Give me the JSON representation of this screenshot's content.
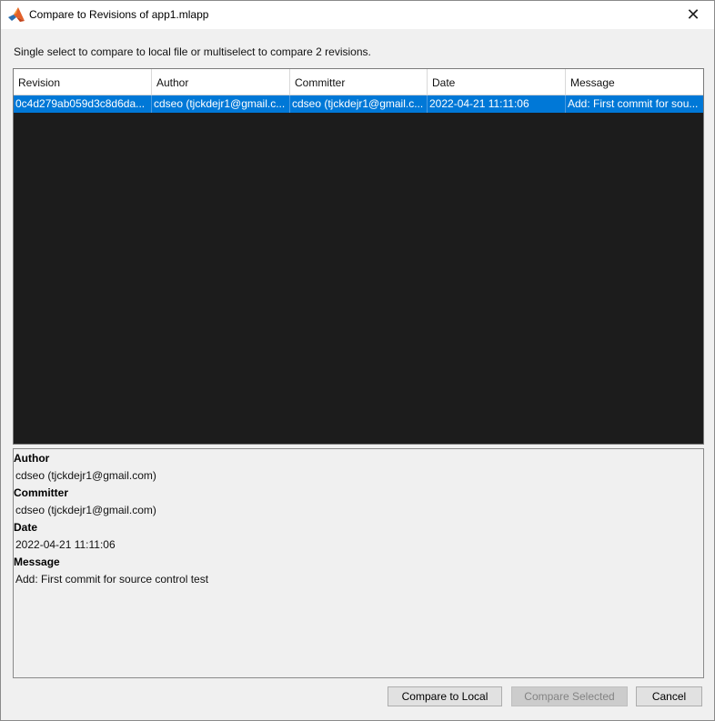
{
  "window": {
    "title": "Compare to Revisions of app1.mlapp",
    "close_icon": "close-icon",
    "app_icon": "matlab-logo-icon"
  },
  "instruction": "Single select to compare to local file or multiselect to compare 2 revisions.",
  "table": {
    "columns": [
      "Revision",
      "Author",
      "Committer",
      "Date",
      "Message"
    ],
    "rows": [
      {
        "revision": "0c4d279ab059d3c8d6da...",
        "author": "cdseo (tjckdejr1@gmail.c...",
        "committer": "cdseo (tjckdejr1@gmail.c...",
        "date": "2022-04-21 11:11:06",
        "message": "Add: First commit for sou...",
        "selected": true
      }
    ],
    "selection_color": "#0078d7"
  },
  "details": {
    "author_label": "Author",
    "author_value": "cdseo (tjckdejr1@gmail.com)",
    "committer_label": "Committer",
    "committer_value": "cdseo (tjckdejr1@gmail.com)",
    "date_label": "Date",
    "date_value": "2022-04-21 11:11:06",
    "message_label": "Message",
    "message_value": "Add: First commit for source control test"
  },
  "buttons": {
    "compare_local": "Compare to Local",
    "compare_selected": "Compare Selected",
    "compare_selected_enabled": false,
    "cancel": "Cancel"
  }
}
